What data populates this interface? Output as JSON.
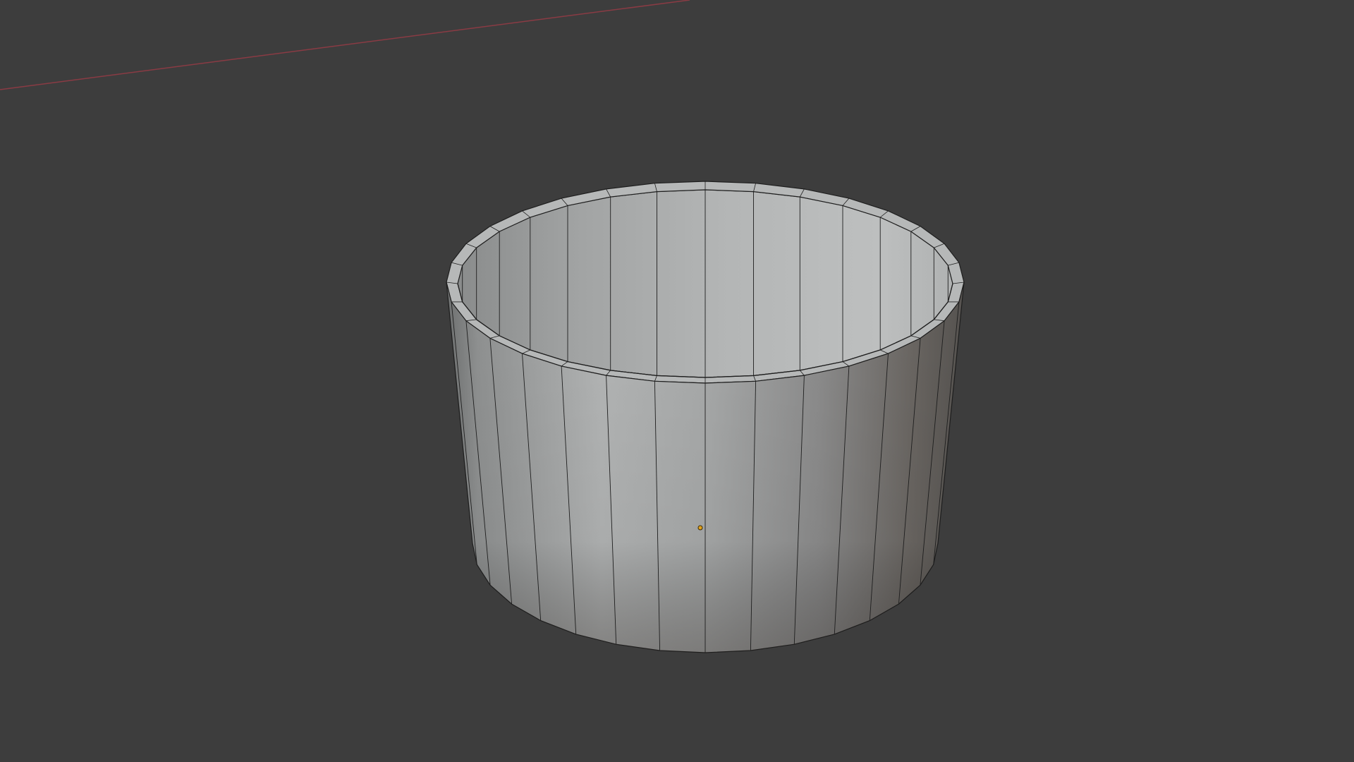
{
  "viewport": {
    "background_color": "#3d3d3d",
    "x_axis_color": "#8a3b44",
    "object_color": "#a9abab",
    "object_edge_color": "#1e1e1e",
    "origin_color": "#e2a21a"
  },
  "scene": {
    "object_type": "open-cylinder-mesh",
    "icons": [
      "x-axis-line",
      "object-origin-icon"
    ]
  }
}
